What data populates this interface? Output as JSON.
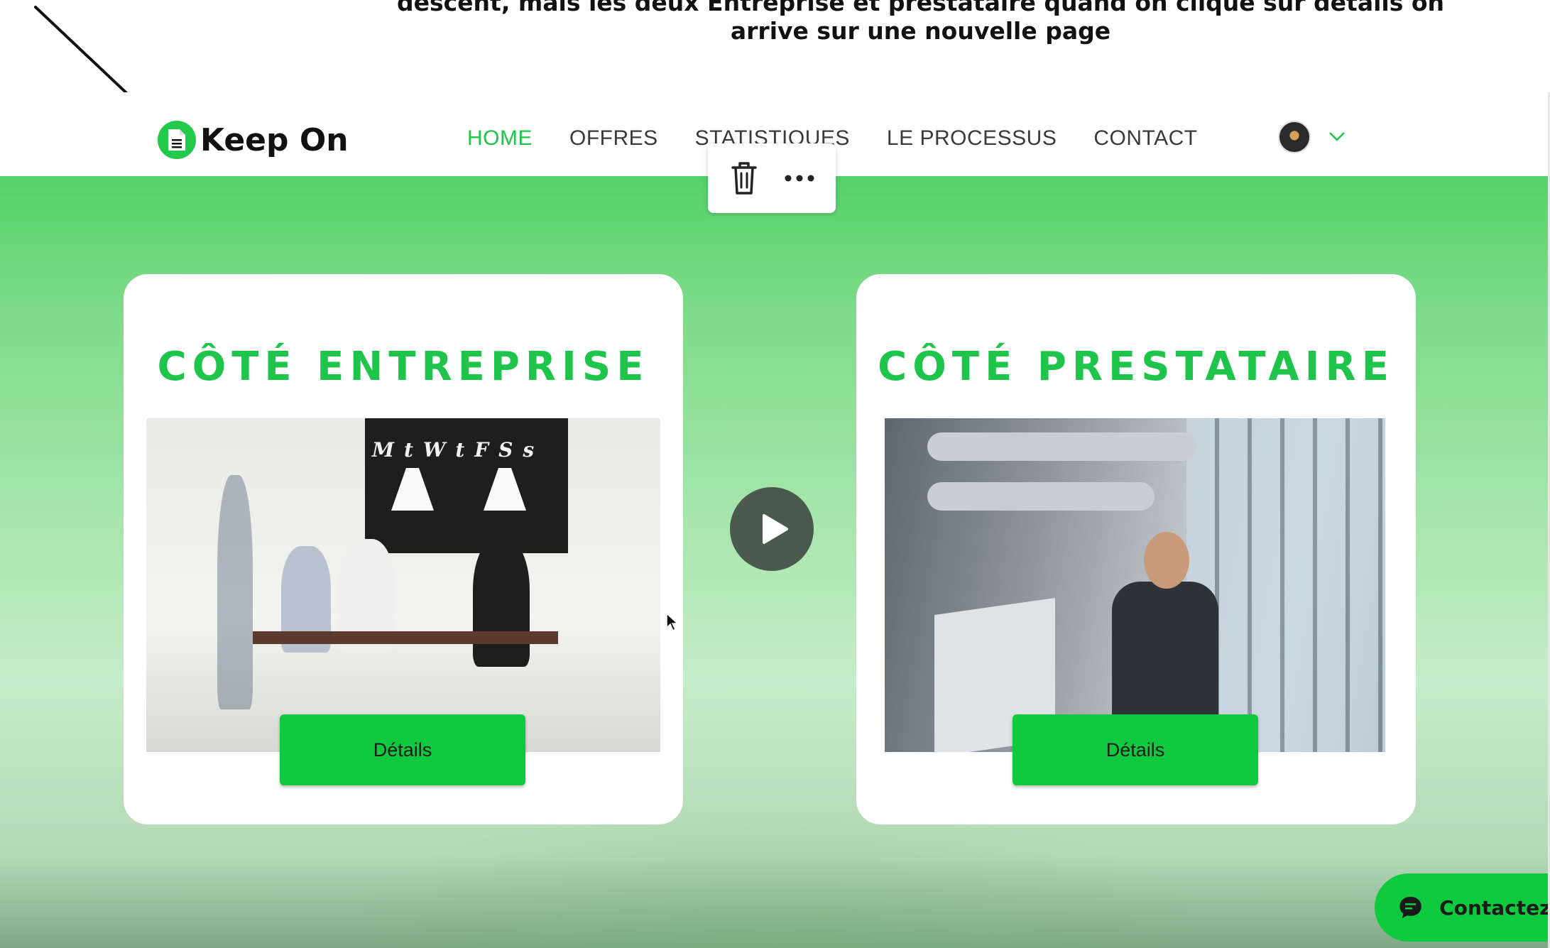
{
  "annotation": {
    "line1": "descent, mais les deux Entreprise et prestataire quand on clique sur details on",
    "line2": "arrive sur une nouvelle page"
  },
  "header": {
    "logo_text": "Keep On",
    "nav": [
      {
        "label": "HOME",
        "active": true
      },
      {
        "label": "OFFRES"
      },
      {
        "label": "STATISTIQUES"
      },
      {
        "label": "LE PROCESSUS"
      },
      {
        "label": "CONTACT"
      }
    ]
  },
  "toolbar": {
    "icons": [
      "trash-icon",
      "more-options-icon"
    ]
  },
  "cards": {
    "left": {
      "title": "CÔTÉ ENTREPRISE",
      "button": "Détails",
      "chalk": "MtWtFSs"
    },
    "right": {
      "title": "CÔTÉ PRESTATAIRE",
      "button": "Détails"
    }
  },
  "contact": {
    "label": "Contactez-"
  },
  "colors": {
    "brand_green": "#1fc44a",
    "button_green": "#0fc93f",
    "text_dark": "#111111"
  }
}
